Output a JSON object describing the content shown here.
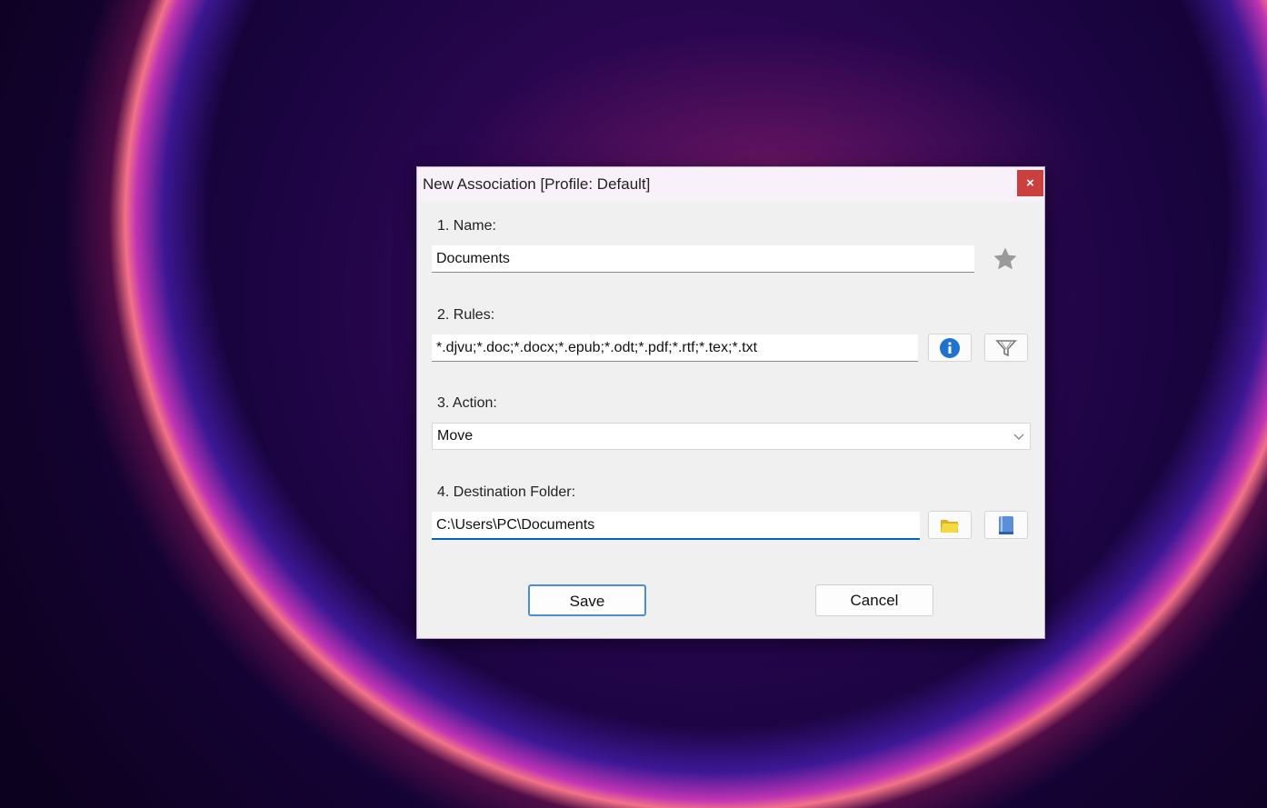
{
  "dialog": {
    "title": "New Association [Profile: Default]",
    "close_label": "×"
  },
  "name": {
    "label": "1. Name:",
    "value": "Documents"
  },
  "rules": {
    "label": "2. Rules:",
    "value": "*.djvu;*.doc;*.docx;*.epub;*.odt;*.pdf;*.rtf;*.tex;*.txt"
  },
  "action": {
    "label": "3. Action:",
    "value": "Move"
  },
  "destination": {
    "label": "4. Destination Folder:",
    "value": "C:\\Users\\PC\\Documents"
  },
  "buttons": {
    "save": "Save",
    "cancel": "Cancel"
  },
  "colors": {
    "accent": "#0067c0",
    "close": "#c9403e"
  }
}
